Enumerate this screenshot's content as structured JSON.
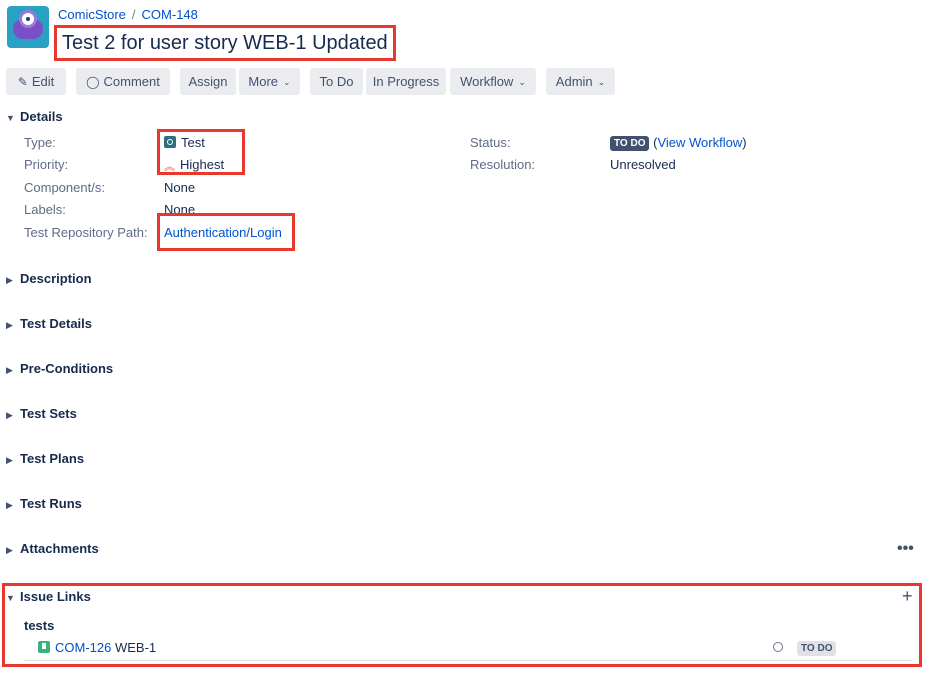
{
  "header": {
    "project": "ComicStore",
    "separator": "/",
    "issue_key": "COM-148",
    "title": "Test 2 for user story WEB-1 Updated"
  },
  "toolbar": {
    "edit": "Edit",
    "comment": "Comment",
    "assign": "Assign",
    "more": "More",
    "todo": "To Do",
    "in_progress": "In Progress",
    "workflow": "Workflow",
    "admin": "Admin"
  },
  "details": {
    "section_title": "Details",
    "type_label": "Type:",
    "type_value": "Test",
    "priority_label": "Priority:",
    "priority_value": "Highest",
    "components_label": "Component/s:",
    "components_value": "None",
    "labels_label": "Labels:",
    "labels_value": "None",
    "repo_path_label": "Test Repository Path:",
    "repo_path_value": "Authentication/Login",
    "status_label": "Status:",
    "status_value": "TO DO",
    "view_workflow": "View Workflow",
    "resolution_label": "Resolution:",
    "resolution_value": "Unresolved"
  },
  "sections": {
    "description": "Description",
    "test_details": "Test Details",
    "pre_conditions": "Pre-Conditions",
    "test_sets": "Test Sets",
    "test_plans": "Test Plans",
    "test_runs": "Test Runs",
    "attachments": "Attachments"
  },
  "issue_links": {
    "section_title": "Issue Links",
    "link_type": "tests",
    "items": [
      {
        "key": "COM-126",
        "summary": "WEB-1",
        "status": "TO DO"
      }
    ]
  },
  "colors": {
    "accent": "#0052cc",
    "highlight": "#e8372c",
    "button_bg": "#ebecf0",
    "status_dark": "#42526e"
  }
}
